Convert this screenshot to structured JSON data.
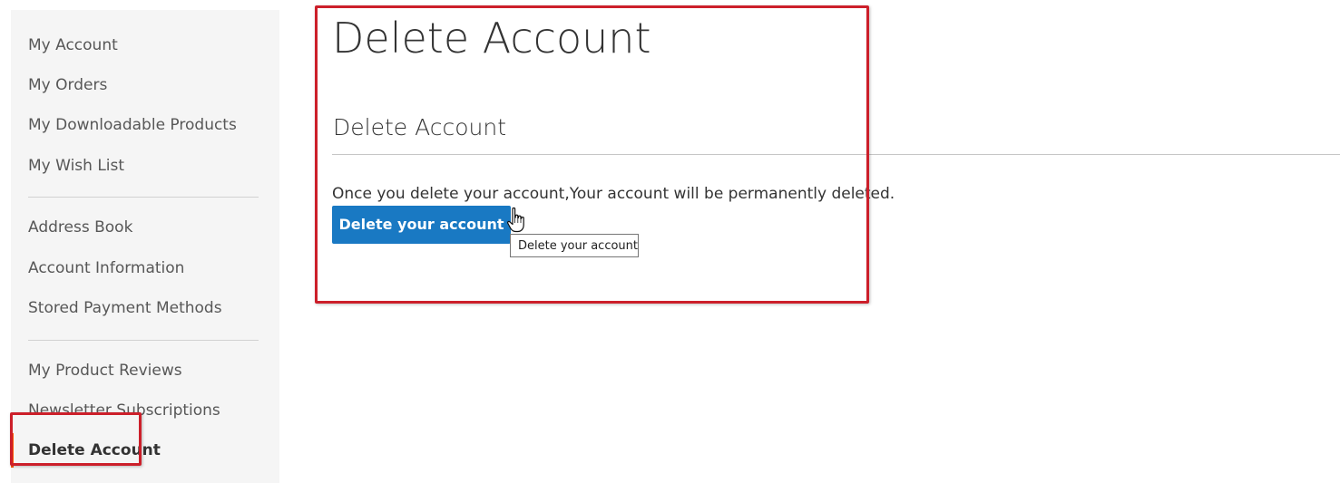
{
  "sidebar": {
    "groups": [
      [
        "My Account",
        "My Orders",
        "My Downloadable Products",
        "My Wish List"
      ],
      [
        "Address Book",
        "Account Information",
        "Stored Payment Methods"
      ],
      [
        "My Product Reviews",
        "Newsletter Subscriptions"
      ]
    ],
    "current": "Delete Account"
  },
  "main": {
    "page_title": "Delete Account",
    "section_title": "Delete Account",
    "message": "Once you delete your account,Your account will be permanently deleted.",
    "delete_button_label": "Delete your account",
    "tooltip": "Delete your account"
  },
  "colors": {
    "primary_button": "#1979c3",
    "highlight_border": "#cc1f2a",
    "active_indicator": "#ff5501",
    "sidebar_bg": "#f5f5f5"
  },
  "icons": {
    "cursor": "hand-pointer-icon"
  }
}
